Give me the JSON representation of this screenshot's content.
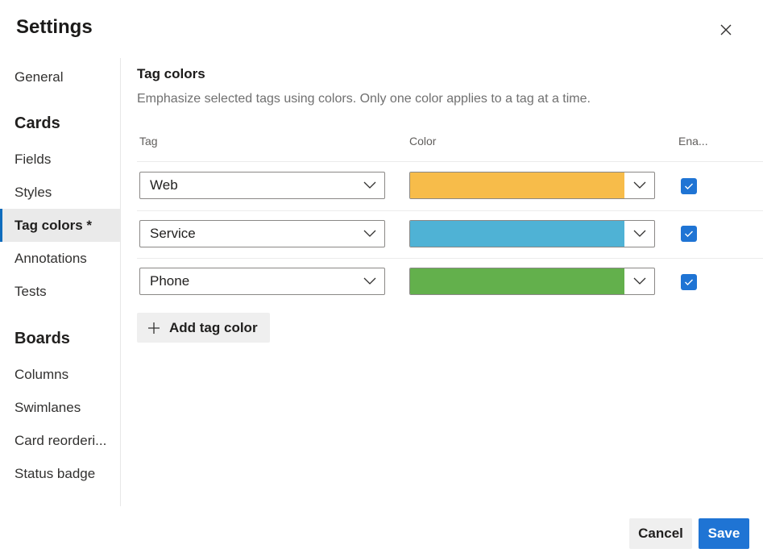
{
  "dialog": {
    "title": "Settings",
    "close_icon": "close-icon"
  },
  "sidebar": {
    "general": "General",
    "sections": [
      {
        "heading": "Cards",
        "items": [
          {
            "label": "Fields",
            "selected": false
          },
          {
            "label": "Styles",
            "selected": false
          },
          {
            "label": "Tag colors *",
            "selected": true
          },
          {
            "label": "Annotations",
            "selected": false
          },
          {
            "label": "Tests",
            "selected": false
          }
        ]
      },
      {
        "heading": "Boards",
        "items": [
          {
            "label": "Columns",
            "selected": false
          },
          {
            "label": "Swimlanes",
            "selected": false
          },
          {
            "label": "Card reorderi...",
            "selected": false
          },
          {
            "label": "Status badge",
            "selected": false
          }
        ]
      }
    ]
  },
  "main": {
    "title": "Tag colors",
    "description": "Emphasize selected tags using colors. Only one color applies to a tag at a time.",
    "columns": {
      "tag": "Tag",
      "color": "Color",
      "enabled": "Ena..."
    },
    "rows": [
      {
        "tag": "Web",
        "color": "#f7bc4a",
        "enabled": true
      },
      {
        "tag": "Service",
        "color": "#4fb2d5",
        "enabled": true
      },
      {
        "tag": "Phone",
        "color": "#63b04c",
        "enabled": true
      }
    ],
    "add_button": {
      "label": "Add tag color",
      "icon": "plus-icon"
    }
  },
  "footer": {
    "cancel_label": "Cancel",
    "save_label": "Save"
  },
  "colors": {
    "accent": "#1f74d4",
    "selected_nav_bg": "#eaeaea",
    "button_neutral": "#efefef"
  }
}
